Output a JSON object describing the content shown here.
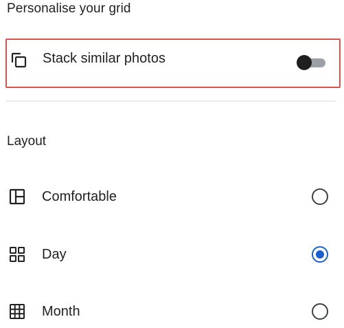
{
  "section_title": "Personalise your grid",
  "stack": {
    "label": "Stack similar photos",
    "icon": "stack-icon",
    "toggle_on": false
  },
  "layout": {
    "title": "Layout",
    "options": [
      {
        "label": "Comfortable",
        "icon": "comfortable-layout-icon",
        "selected": false
      },
      {
        "label": "Day",
        "icon": "day-layout-icon",
        "selected": true
      },
      {
        "label": "Month",
        "icon": "month-layout-icon",
        "selected": false
      }
    ]
  },
  "colors": {
    "highlight_border": "#d9534a",
    "accent": "#1a5fd1",
    "text": "#202124"
  }
}
